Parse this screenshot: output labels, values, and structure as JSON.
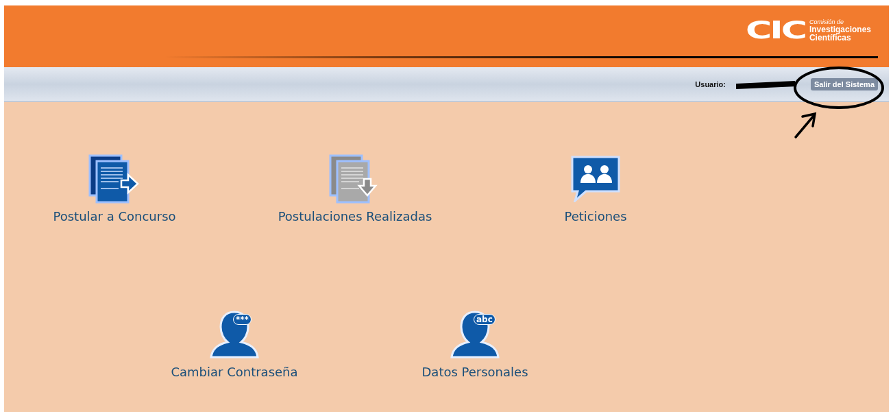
{
  "header": {
    "logo_mark": "CIC",
    "logo_lines": [
      "Comisión de",
      "Investigaciones",
      "Científicas"
    ]
  },
  "user_bar": {
    "user_label": "Usuario:",
    "logout": "Salir del Sistema"
  },
  "annotations": [
    {
      "kind": "redaction"
    },
    {
      "kind": "ellipse"
    },
    {
      "kind": "arrow"
    }
  ],
  "menu_rows": [
    [
      {
        "label": "Postular a Concurso",
        "kind": "send"
      },
      {
        "label": "Postulaciones Realizadas",
        "kind": "received"
      },
      {
        "label": "Peticiones",
        "kind": "chat"
      }
    ],
    [
      {
        "label": "Cambiar Contraseña",
        "kind": "person",
        "icon_text": "***"
      },
      {
        "label": "Datos Personales",
        "kind": "person",
        "icon_text": "abc"
      }
    ]
  ]
}
